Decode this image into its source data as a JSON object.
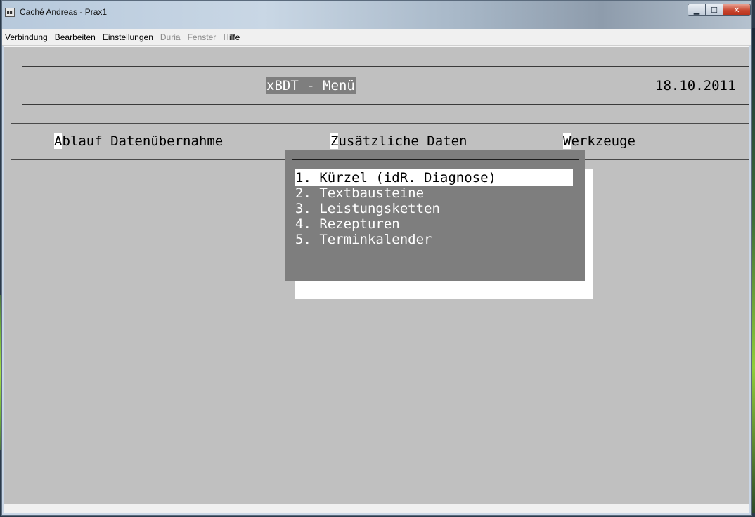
{
  "window": {
    "title": "Caché Andreas - Prax1",
    "controls": {
      "minimize": "▁",
      "maximize": "☐",
      "close": "✕"
    }
  },
  "menubar": [
    {
      "first": "V",
      "rest": "erbindung",
      "enabled": true
    },
    {
      "first": "B",
      "rest": "earbeiten",
      "enabled": true
    },
    {
      "first": "E",
      "rest": "instellungen",
      "enabled": true
    },
    {
      "first": "D",
      "rest": "uria",
      "enabled": false
    },
    {
      "first": "F",
      "rest": "enster",
      "enabled": false
    },
    {
      "first": "H",
      "rest": "ilfe",
      "enabled": true
    }
  ],
  "terminal": {
    "header_title": "xBDT - Menü",
    "date": "18.10.2011",
    "menu": [
      {
        "hotkey": "A",
        "rest": "blauf Datenübernahme"
      },
      {
        "hotkey": "Z",
        "rest": "usätzliche Daten"
      },
      {
        "hotkey": "W",
        "rest": "erkzeuge"
      }
    ],
    "dropdown_items": [
      "1. Kürzel (idR. Diagnose)",
      "2. Textbausteine",
      "3. Leistungsketten",
      "4. Rezepturen",
      "5. Terminkalender"
    ],
    "selected_index": 0
  }
}
